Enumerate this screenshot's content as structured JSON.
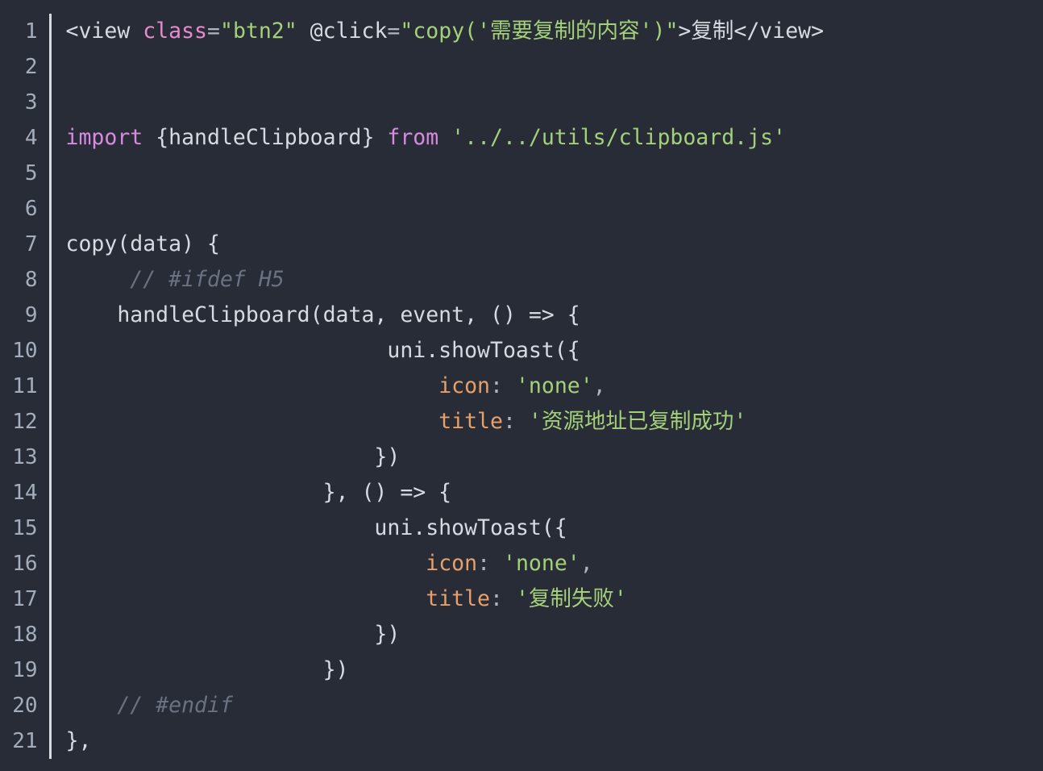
{
  "editor": {
    "name": "code-snippet-viewer",
    "theme": "one-dark",
    "language": "javascript-vue",
    "background_color": "#282c37",
    "gutter_separator_color": "#d7dae0",
    "line_number_color": "#a4adbb",
    "colors": {
      "plain": "#d6dae1",
      "attribute": "#e88ad0",
      "keyword": "#d78ae0",
      "string": "#a4d07a",
      "property": "#e8a06a",
      "punctuation": "#aeb4c0",
      "comment": "#6a7281"
    },
    "total_lines": 21,
    "line_numbers": [
      "1",
      "2",
      "3",
      "4",
      "5",
      "6",
      "7",
      "8",
      "9",
      "10",
      "11",
      "12",
      "13",
      "14",
      "15",
      "16",
      "17",
      "18",
      "19",
      "20",
      "21"
    ],
    "lines": [
      {
        "number": "1",
        "text": "<view class=\"btn2\" @click=\"copy('需要复制的内容')\">复制</view>",
        "tokens": [
          {
            "t": "<view ",
            "c": "t-plain"
          },
          {
            "t": "class",
            "c": "t-attr"
          },
          {
            "t": "=",
            "c": "t-punct"
          },
          {
            "t": "\"btn2\"",
            "c": "t-string"
          },
          {
            "t": " @click",
            "c": "t-plain"
          },
          {
            "t": "=",
            "c": "t-punct"
          },
          {
            "t": "\"copy('需要复制的内容')\"",
            "c": "t-string"
          },
          {
            "t": ">复制</view>",
            "c": "t-plain"
          }
        ]
      },
      {
        "number": "2",
        "text": "",
        "tokens": []
      },
      {
        "number": "3",
        "text": "",
        "tokens": []
      },
      {
        "number": "4",
        "text": "import {handleClipboard} from '../../utils/clipboard.js'",
        "tokens": [
          {
            "t": "import",
            "c": "t-keyword"
          },
          {
            "t": " {handleClipboard} ",
            "c": "t-plain"
          },
          {
            "t": "from",
            "c": "t-keyword"
          },
          {
            "t": " ",
            "c": "t-plain"
          },
          {
            "t": "'../../utils/clipboard.js'",
            "c": "t-string"
          }
        ]
      },
      {
        "number": "5",
        "text": "",
        "tokens": []
      },
      {
        "number": "6",
        "text": "",
        "tokens": []
      },
      {
        "number": "7",
        "text": "copy(data) {",
        "tokens": [
          {
            "t": "copy(data) {",
            "c": "t-plain"
          }
        ]
      },
      {
        "number": "8",
        "text": "     // #ifdef H5",
        "tokens": [
          {
            "t": "     ",
            "c": "t-plain"
          },
          {
            "t": "// #ifdef H5",
            "c": "t-comment"
          }
        ]
      },
      {
        "number": "9",
        "text": "    handleClipboard(data, event, () => {",
        "tokens": [
          {
            "t": "    handleClipboard(data, event, () => {",
            "c": "t-plain"
          }
        ]
      },
      {
        "number": "10",
        "text": "                         uni.showToast({",
        "tokens": [
          {
            "t": "                         uni.showToast({",
            "c": "t-plain"
          }
        ]
      },
      {
        "number": "11",
        "text": "                             icon: 'none',",
        "tokens": [
          {
            "t": "                             ",
            "c": "t-plain"
          },
          {
            "t": "icon",
            "c": "t-prop"
          },
          {
            "t": ":",
            "c": "t-punct"
          },
          {
            "t": " ",
            "c": "t-plain"
          },
          {
            "t": "'none'",
            "c": "t-string"
          },
          {
            "t": ",",
            "c": "t-punct"
          }
        ]
      },
      {
        "number": "12",
        "text": "                             title: '资源地址已复制成功'",
        "tokens": [
          {
            "t": "                             ",
            "c": "t-plain"
          },
          {
            "t": "title",
            "c": "t-prop"
          },
          {
            "t": ":",
            "c": "t-punct"
          },
          {
            "t": " ",
            "c": "t-plain"
          },
          {
            "t": "'资源地址已复制成功'",
            "c": "t-string"
          }
        ]
      },
      {
        "number": "13",
        "text": "                        })",
        "tokens": [
          {
            "t": "                        })",
            "c": "t-plain"
          }
        ]
      },
      {
        "number": "14",
        "text": "                    }, () => {",
        "tokens": [
          {
            "t": "                    }, () => {",
            "c": "t-plain"
          }
        ]
      },
      {
        "number": "15",
        "text": "                        uni.showToast({",
        "tokens": [
          {
            "t": "                        uni.showToast({",
            "c": "t-plain"
          }
        ]
      },
      {
        "number": "16",
        "text": "                            icon: 'none',",
        "tokens": [
          {
            "t": "                            ",
            "c": "t-plain"
          },
          {
            "t": "icon",
            "c": "t-prop"
          },
          {
            "t": ":",
            "c": "t-punct"
          },
          {
            "t": " ",
            "c": "t-plain"
          },
          {
            "t": "'none'",
            "c": "t-string"
          },
          {
            "t": ",",
            "c": "t-punct"
          }
        ]
      },
      {
        "number": "17",
        "text": "                            title: '复制失败'",
        "tokens": [
          {
            "t": "                            ",
            "c": "t-plain"
          },
          {
            "t": "title",
            "c": "t-prop"
          },
          {
            "t": ":",
            "c": "t-punct"
          },
          {
            "t": " ",
            "c": "t-plain"
          },
          {
            "t": "'复制失败'",
            "c": "t-string"
          }
        ]
      },
      {
        "number": "18",
        "text": "                        })",
        "tokens": [
          {
            "t": "                        })",
            "c": "t-plain"
          }
        ]
      },
      {
        "number": "19",
        "text": "                    })",
        "tokens": [
          {
            "t": "                    })",
            "c": "t-plain"
          }
        ]
      },
      {
        "number": "20",
        "text": "    // #endif",
        "tokens": [
          {
            "t": "    ",
            "c": "t-plain"
          },
          {
            "t": "// #endif",
            "c": "t-comment"
          }
        ]
      },
      {
        "number": "21",
        "text": "},",
        "tokens": [
          {
            "t": "},",
            "c": "t-plain"
          }
        ]
      }
    ]
  }
}
